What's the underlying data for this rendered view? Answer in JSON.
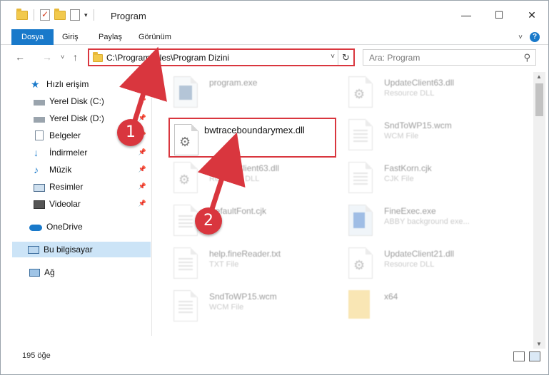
{
  "window": {
    "title": "Program"
  },
  "ribbon": {
    "tabs": [
      "Dosya",
      "Giriş",
      "Paylaş",
      "Görünüm"
    ],
    "active_tab": "Dosya"
  },
  "navigation": {
    "address": "C:\\Program Files\\Program Dizini",
    "search_placeholder": "Ara: Program"
  },
  "sidebar": {
    "items": [
      {
        "label": "Hızlı erişim",
        "icon": "star-icon",
        "pinned": false
      },
      {
        "label": "Yerel Disk (C:)",
        "icon": "drive-icon",
        "pinned": true
      },
      {
        "label": "Yerel Disk (D:)",
        "icon": "drive-icon",
        "pinned": true
      },
      {
        "label": "Belgeler",
        "icon": "documents-icon",
        "pinned": true
      },
      {
        "label": "İndirmeler",
        "icon": "download-icon",
        "pinned": true
      },
      {
        "label": "Müzik",
        "icon": "music-icon",
        "pinned": true
      },
      {
        "label": "Resimler",
        "icon": "pictures-icon",
        "pinned": true
      },
      {
        "label": "Videolar",
        "icon": "videos-icon",
        "pinned": true
      },
      {
        "label": "OneDrive",
        "icon": "cloud-icon",
        "pinned": false
      },
      {
        "label": "Bu bilgisayar",
        "icon": "computer-icon",
        "pinned": false
      },
      {
        "label": "Ağ",
        "icon": "network-icon",
        "pinned": false
      }
    ],
    "selected": "Bu bilgisayar"
  },
  "files": {
    "left": [
      {
        "name": "program.exe",
        "type": ""
      },
      {
        "name": "bwtraceboundarymex.dll",
        "type": ""
      },
      {
        "name": "UpdateClient63.dll",
        "type": "Resource DLL"
      },
      {
        "name": "DefaultFont.cjk",
        "type": "File"
      },
      {
        "name": "help.fineReader.txt",
        "type": "TXT File"
      },
      {
        "name": "SndToWP15.wcm",
        "type": "WCM File"
      }
    ],
    "right": [
      {
        "name": "UpdateClient63.dll",
        "type": "Resource DLL"
      },
      {
        "name": "SndToWP15.wcm",
        "type": "WCM File"
      },
      {
        "name": "FastKorn.cjk",
        "type": "CJK File"
      },
      {
        "name": "FineExec.exe",
        "type": "ABBY background exe..."
      },
      {
        "name": "UpdateClient21.dll",
        "type": "Resource DLL"
      },
      {
        "name": "x64",
        "type": ""
      }
    ]
  },
  "status": {
    "item_count": "195 öğe"
  },
  "callouts": [
    "1",
    "2"
  ],
  "colors": {
    "accent": "#1979ca",
    "highlight": "#d9363e",
    "selected": "#cce4f7"
  }
}
